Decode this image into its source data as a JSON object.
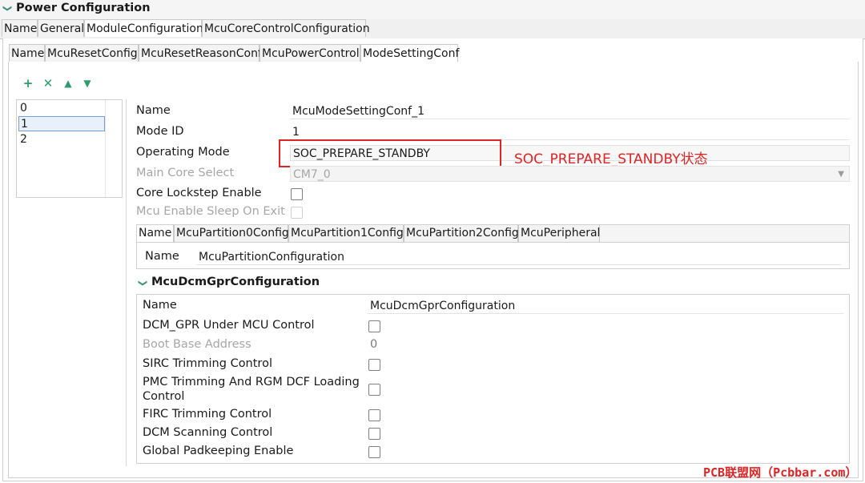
{
  "header": {
    "title": "Power Configuration"
  },
  "top_tabs": [
    "Name",
    "General",
    "ModuleConfiguration",
    "McuCoreControlConfiguration"
  ],
  "sub_tabs": [
    "Name",
    "McuResetConfig",
    "McuResetReasonConf",
    "McuPowerControl",
    "ModeSettingConf"
  ],
  "list_items": [
    "0",
    "1",
    "2"
  ],
  "form": {
    "name_label": "Name",
    "name_value": "McuModeSettingConf_1",
    "mode_id_label": "Mode ID",
    "mode_id_value": "1",
    "operating_mode_label": "Operating Mode",
    "operating_mode_value": "SOC_PREPARE_STANDBY",
    "main_core_label": "Main Core Select",
    "main_core_value": "CM7_0",
    "lockstep_label": "Core Lockstep Enable",
    "sleep_label": "Mcu Enable Sleep On Exit"
  },
  "annotation": "SOC_PREPARE_STANDBY状态",
  "partition_tabs": [
    "Name",
    "McuPartition0Config",
    "McuPartition1Config",
    "McuPartition2Config",
    "McuPeripheral"
  ],
  "partition": {
    "name_label": "Name",
    "name_value": "McuPartitionConfiguration"
  },
  "dcm": {
    "title": "McuDcmGprConfiguration",
    "name_label": "Name",
    "name_value": "McuDcmGprConfiguration",
    "under_mcu_label": "DCM_GPR Under MCU Control",
    "boot_label": "Boot Base Address",
    "boot_value": "0",
    "sirc_label": "SIRC Trimming Control",
    "pmc_label_1": "PMC Trimming And RGM DCF Loading",
    "pmc_label_2": "Control",
    "firc_label": "FIRC Trimming Control",
    "scan_label": "DCM Scanning Control",
    "pad_label": "Global Padkeeping Enable"
  },
  "watermark": "PCB联盟网（Pcbbar.com）"
}
